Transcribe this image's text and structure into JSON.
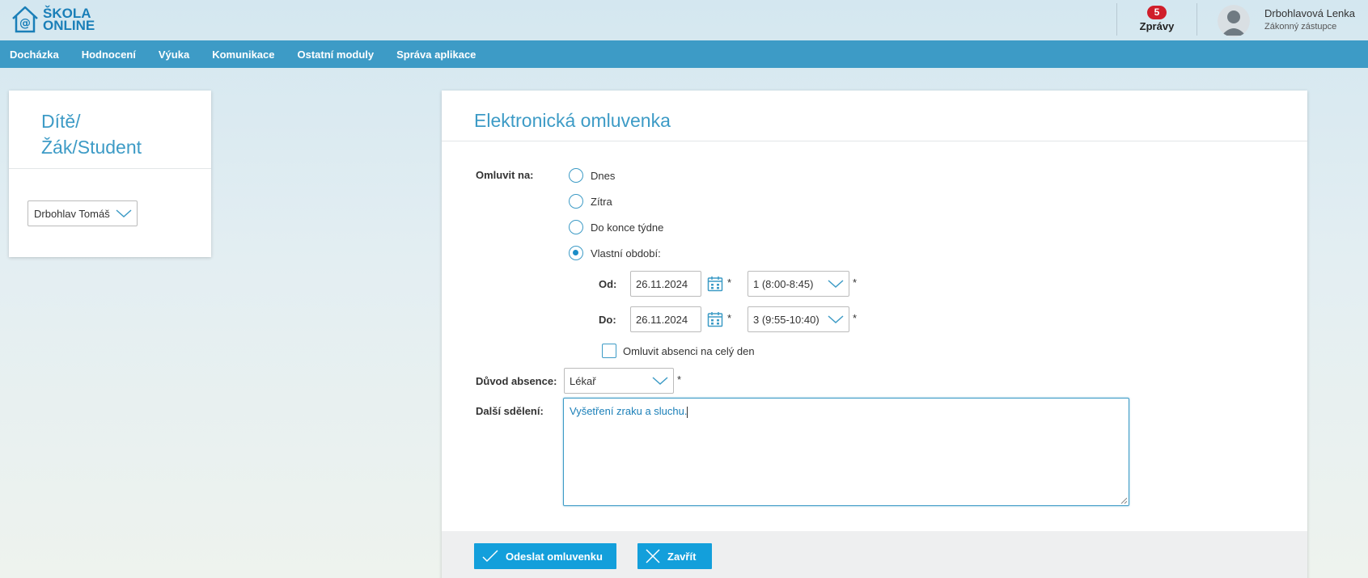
{
  "header": {
    "logo_line1": "ŠKOLA",
    "logo_line2": "ONLINE",
    "messages_count": "5",
    "messages_label": "Zprávy",
    "user_name": "Drbohlavová Lenka",
    "user_role": "Zákonný zástupce"
  },
  "nav": {
    "items": [
      "Docházka",
      "Hodnocení",
      "Výuka",
      "Komunikace",
      "Ostatní moduly",
      "Správa aplikace"
    ]
  },
  "left_panel": {
    "title_line1": "Dítě/",
    "title_line2": "Žák/Student",
    "child_selected": "Drbohlav Tomáš"
  },
  "form": {
    "title": "Elektronická omluvenka",
    "excuse_for_label": "Omluvit na:",
    "options": [
      "Dnes",
      "Zítra",
      "Do konce týdne",
      "Vlastní období:"
    ],
    "selected_option": "Vlastní období:",
    "from_label": "Od:",
    "to_label": "Do:",
    "from_date": "26.11.2024",
    "to_date": "26.11.2024",
    "from_lesson": "1 (8:00-8:45)",
    "to_lesson": "3 (9:55-10:40)",
    "required_mark": "*",
    "whole_day_label": "Omluvit absenci na celý den",
    "whole_day_checked": false,
    "reason_label": "Důvod absence:",
    "reason_value": "Lékař",
    "note_label": "Další sdělení:",
    "note_value": "Vyšetření zraku a sluchu."
  },
  "buttons": {
    "submit": "Odeslat omluvenku",
    "close": "Zavřít"
  },
  "colors": {
    "nav_bg": "#3d9bc6",
    "accent": "#139fdb",
    "badge": "#d01e2a"
  }
}
